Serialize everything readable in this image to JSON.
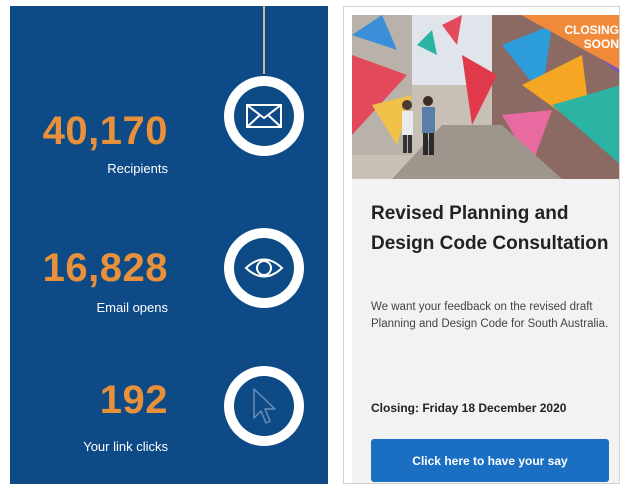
{
  "stats": [
    {
      "value": "40,170",
      "label": "Recipients",
      "icon": "envelope-icon"
    },
    {
      "value": "16,828",
      "label": "Email opens",
      "icon": "eye-icon"
    },
    {
      "value": "192",
      "label": "Your link clicks",
      "icon": "cursor-icon"
    }
  ],
  "card": {
    "badge": "CLOSING SOON",
    "title": "Revised Planning and Design Code Consultation",
    "description": "We want your feedback on the revised draft Planning and Design Code for South Australia.",
    "closing": "Closing: Friday 18 December 2020",
    "cta_label": "Click here to have your say"
  },
  "colors": {
    "panel_bg": "#0d4a86",
    "stat_value": "#e8913a",
    "button_bg": "#1a6fc2",
    "badge_bg": "#f08a3a"
  }
}
